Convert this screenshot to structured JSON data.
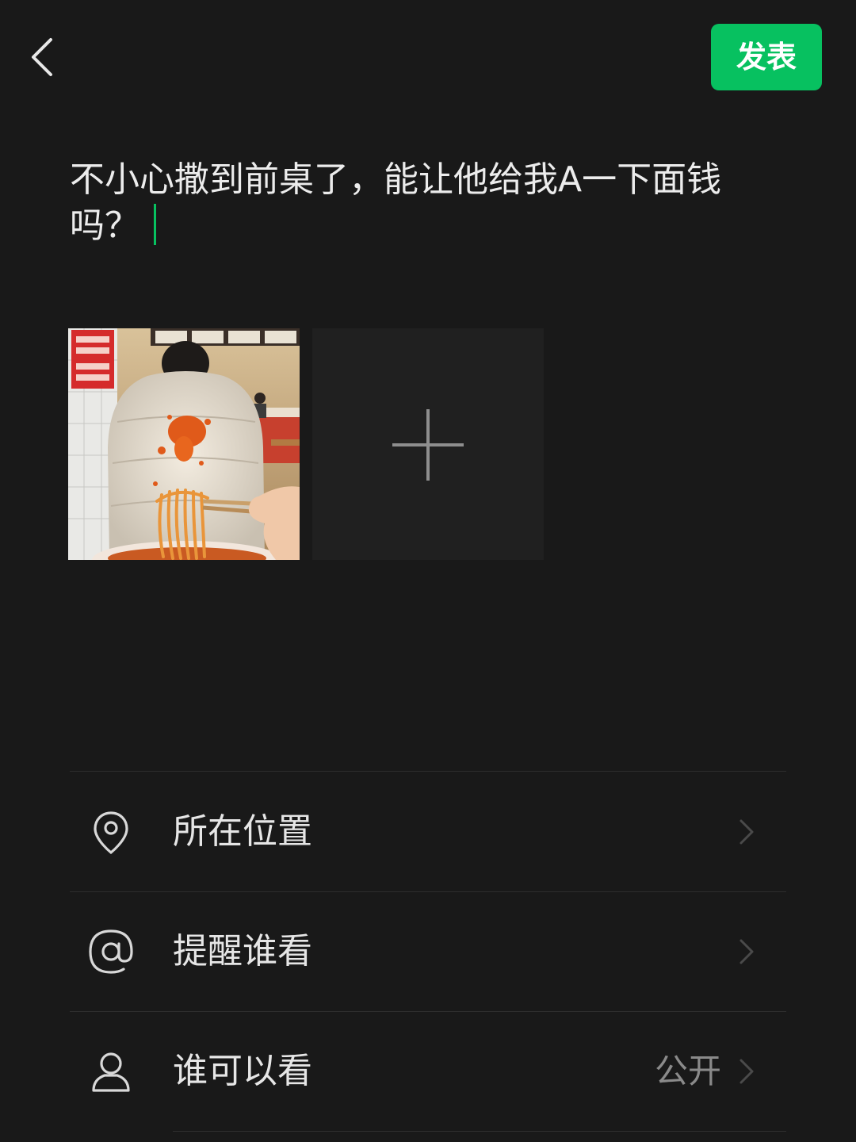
{
  "header": {
    "back_icon": "chevron-left-icon",
    "post_label": "发表"
  },
  "compose": {
    "text": "不小心撒到前桌了，能让他给我A一下面钱吗？"
  },
  "photos": {
    "items": [
      {
        "description_icon": "photo-thumbnail"
      }
    ],
    "add_icon": "plus-icon"
  },
  "options": [
    {
      "label": "所在位置",
      "icon": "location-pin-icon",
      "value": ""
    },
    {
      "label": "提醒谁看",
      "icon": "at-sign-icon",
      "value": ""
    },
    {
      "label": "谁可以看",
      "icon": "person-icon",
      "value": "公开"
    }
  ],
  "colors": {
    "accent": "#07c160",
    "background": "#191919",
    "text": "#e8e8e8",
    "muted": "#8a8a8a"
  }
}
